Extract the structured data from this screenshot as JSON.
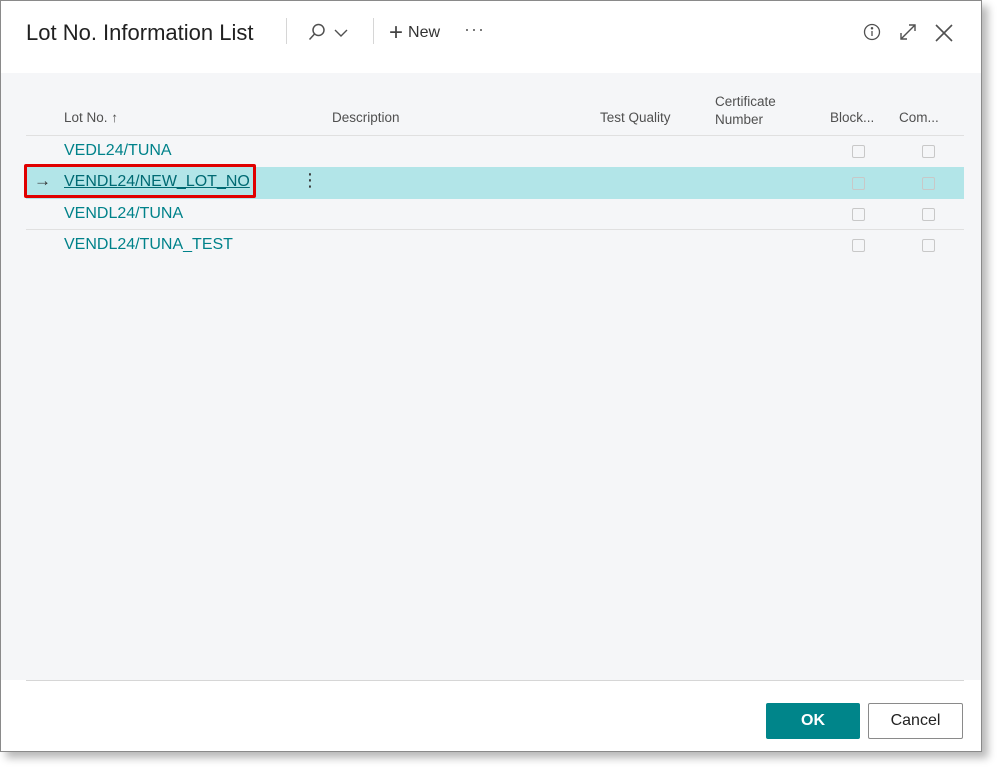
{
  "dialog": {
    "title": "Lot No. Information List",
    "new_label": "New",
    "more_actions": "···"
  },
  "columns": {
    "lot_no": "Lot No. ↑",
    "description": "Description",
    "test_quality": "Test Quality",
    "certificate_line1": "Certificate",
    "certificate_line2": "Number",
    "blocked": "Block...",
    "comment": "Com..."
  },
  "rows": [
    {
      "lot_no": "VEDL24/TUNA",
      "selected": false
    },
    {
      "lot_no": "VENDL24/NEW_LOT_NO",
      "selected": true
    },
    {
      "lot_no": "VENDL24/TUNA",
      "selected": false
    },
    {
      "lot_no": "VENDL24/TUNA_TEST",
      "selected": false
    }
  ],
  "row_indicator": "→",
  "row_menu": "⋮",
  "buttons": {
    "ok": "OK",
    "cancel": "Cancel"
  },
  "colors": {
    "accent": "#00858a",
    "selected_row": "#b2e5e8",
    "link": "#00828a",
    "highlight_box": "#e00000"
  },
  "icons": {
    "search": "search-icon",
    "chevron": "chevron-down-icon",
    "add": "plus-icon",
    "info": "info-icon",
    "expand": "expand-icon",
    "close": "close-icon"
  }
}
